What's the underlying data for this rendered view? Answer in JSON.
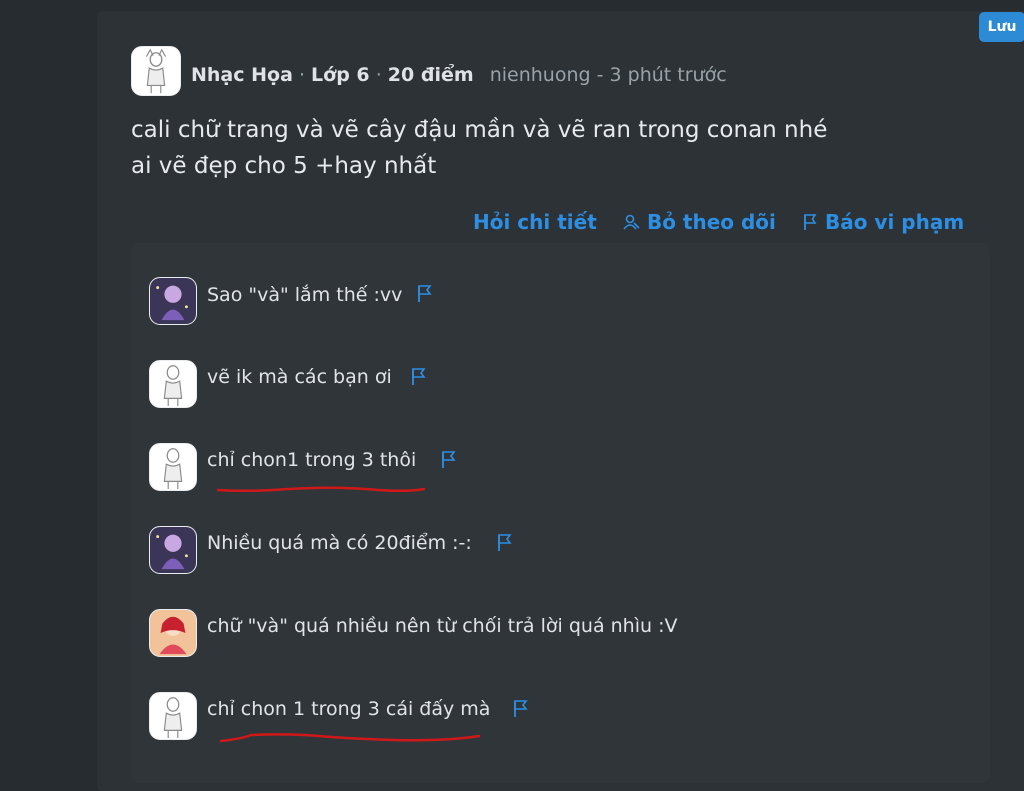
{
  "save_label": "Lưu",
  "post": {
    "subject": "Nhạc Họa",
    "grade": "Lớp 6",
    "points": "20 điểm",
    "dot": "·",
    "author": "nienhuong",
    "time_sep": "-",
    "time": "3 phút trước",
    "question_line1": "cali chữ trang và vẽ cây đậu mần và vẽ ran trong conan nhé",
    "question_line2": "ai vẽ đẹp cho 5 +hay nhất"
  },
  "actions": {
    "ask_detail": "Hỏi chi tiết",
    "unfollow": "Bỏ theo dõi",
    "report": "Báo vi phạm"
  },
  "comments": [
    {
      "text": "Sao \"và\" lắm thế :vv",
      "avatar": "anime-purple"
    },
    {
      "text": "vẽ ik mà các bạn ơi",
      "avatar": "sketch"
    },
    {
      "text": "chỉ chon1 trong 3 thôi",
      "avatar": "sketch"
    },
    {
      "text": "Nhiều quá mà có 20điểm :-:",
      "avatar": "anime-purple"
    },
    {
      "text": "chữ \"và\" quá nhiều nên từ chối trả lời quá nhìu :V",
      "avatar": "anime-red"
    },
    {
      "text": "chỉ chon 1 trong 3 cái đấy mà",
      "avatar": "sketch"
    }
  ],
  "colors": {
    "accent": "#2d8fe4",
    "background": "#262c30",
    "card": "#2c3236",
    "annotation_red": "#d11818"
  }
}
